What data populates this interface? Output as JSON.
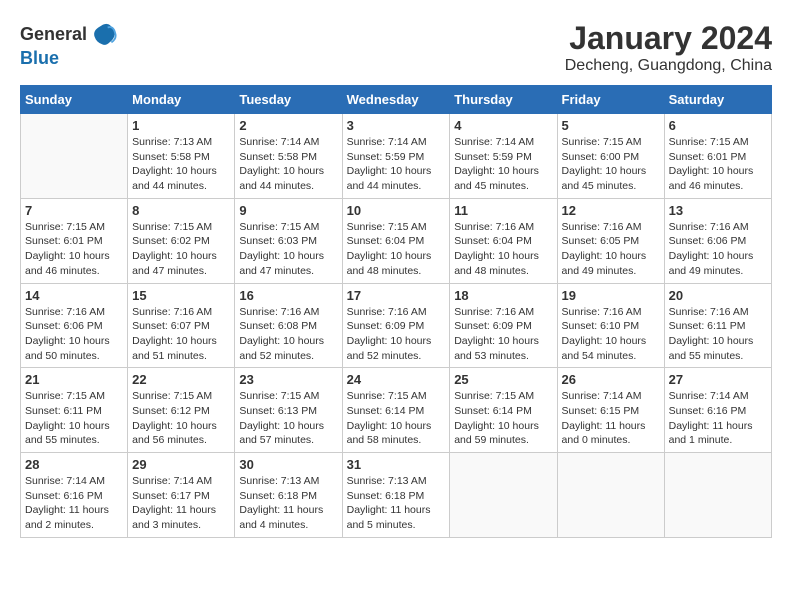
{
  "header": {
    "logo_general": "General",
    "logo_blue": "Blue",
    "month": "January 2024",
    "location": "Decheng, Guangdong, China"
  },
  "days_of_week": [
    "Sunday",
    "Monday",
    "Tuesday",
    "Wednesday",
    "Thursday",
    "Friday",
    "Saturday"
  ],
  "weeks": [
    [
      {
        "day": "",
        "info": ""
      },
      {
        "day": "1",
        "info": "Sunrise: 7:13 AM\nSunset: 5:58 PM\nDaylight: 10 hours\nand 44 minutes."
      },
      {
        "day": "2",
        "info": "Sunrise: 7:14 AM\nSunset: 5:58 PM\nDaylight: 10 hours\nand 44 minutes."
      },
      {
        "day": "3",
        "info": "Sunrise: 7:14 AM\nSunset: 5:59 PM\nDaylight: 10 hours\nand 44 minutes."
      },
      {
        "day": "4",
        "info": "Sunrise: 7:14 AM\nSunset: 5:59 PM\nDaylight: 10 hours\nand 45 minutes."
      },
      {
        "day": "5",
        "info": "Sunrise: 7:15 AM\nSunset: 6:00 PM\nDaylight: 10 hours\nand 45 minutes."
      },
      {
        "day": "6",
        "info": "Sunrise: 7:15 AM\nSunset: 6:01 PM\nDaylight: 10 hours\nand 46 minutes."
      }
    ],
    [
      {
        "day": "7",
        "info": "Sunrise: 7:15 AM\nSunset: 6:01 PM\nDaylight: 10 hours\nand 46 minutes."
      },
      {
        "day": "8",
        "info": "Sunrise: 7:15 AM\nSunset: 6:02 PM\nDaylight: 10 hours\nand 47 minutes."
      },
      {
        "day": "9",
        "info": "Sunrise: 7:15 AM\nSunset: 6:03 PM\nDaylight: 10 hours\nand 47 minutes."
      },
      {
        "day": "10",
        "info": "Sunrise: 7:15 AM\nSunset: 6:04 PM\nDaylight: 10 hours\nand 48 minutes."
      },
      {
        "day": "11",
        "info": "Sunrise: 7:16 AM\nSunset: 6:04 PM\nDaylight: 10 hours\nand 48 minutes."
      },
      {
        "day": "12",
        "info": "Sunrise: 7:16 AM\nSunset: 6:05 PM\nDaylight: 10 hours\nand 49 minutes."
      },
      {
        "day": "13",
        "info": "Sunrise: 7:16 AM\nSunset: 6:06 PM\nDaylight: 10 hours\nand 49 minutes."
      }
    ],
    [
      {
        "day": "14",
        "info": "Sunrise: 7:16 AM\nSunset: 6:06 PM\nDaylight: 10 hours\nand 50 minutes."
      },
      {
        "day": "15",
        "info": "Sunrise: 7:16 AM\nSunset: 6:07 PM\nDaylight: 10 hours\nand 51 minutes."
      },
      {
        "day": "16",
        "info": "Sunrise: 7:16 AM\nSunset: 6:08 PM\nDaylight: 10 hours\nand 52 minutes."
      },
      {
        "day": "17",
        "info": "Sunrise: 7:16 AM\nSunset: 6:09 PM\nDaylight: 10 hours\nand 52 minutes."
      },
      {
        "day": "18",
        "info": "Sunrise: 7:16 AM\nSunset: 6:09 PM\nDaylight: 10 hours\nand 53 minutes."
      },
      {
        "day": "19",
        "info": "Sunrise: 7:16 AM\nSunset: 6:10 PM\nDaylight: 10 hours\nand 54 minutes."
      },
      {
        "day": "20",
        "info": "Sunrise: 7:16 AM\nSunset: 6:11 PM\nDaylight: 10 hours\nand 55 minutes."
      }
    ],
    [
      {
        "day": "21",
        "info": "Sunrise: 7:15 AM\nSunset: 6:11 PM\nDaylight: 10 hours\nand 55 minutes."
      },
      {
        "day": "22",
        "info": "Sunrise: 7:15 AM\nSunset: 6:12 PM\nDaylight: 10 hours\nand 56 minutes."
      },
      {
        "day": "23",
        "info": "Sunrise: 7:15 AM\nSunset: 6:13 PM\nDaylight: 10 hours\nand 57 minutes."
      },
      {
        "day": "24",
        "info": "Sunrise: 7:15 AM\nSunset: 6:14 PM\nDaylight: 10 hours\nand 58 minutes."
      },
      {
        "day": "25",
        "info": "Sunrise: 7:15 AM\nSunset: 6:14 PM\nDaylight: 10 hours\nand 59 minutes."
      },
      {
        "day": "26",
        "info": "Sunrise: 7:14 AM\nSunset: 6:15 PM\nDaylight: 11 hours\nand 0 minutes."
      },
      {
        "day": "27",
        "info": "Sunrise: 7:14 AM\nSunset: 6:16 PM\nDaylight: 11 hours\nand 1 minute."
      }
    ],
    [
      {
        "day": "28",
        "info": "Sunrise: 7:14 AM\nSunset: 6:16 PM\nDaylight: 11 hours\nand 2 minutes."
      },
      {
        "day": "29",
        "info": "Sunrise: 7:14 AM\nSunset: 6:17 PM\nDaylight: 11 hours\nand 3 minutes."
      },
      {
        "day": "30",
        "info": "Sunrise: 7:13 AM\nSunset: 6:18 PM\nDaylight: 11 hours\nand 4 minutes."
      },
      {
        "day": "31",
        "info": "Sunrise: 7:13 AM\nSunset: 6:18 PM\nDaylight: 11 hours\nand 5 minutes."
      },
      {
        "day": "",
        "info": ""
      },
      {
        "day": "",
        "info": ""
      },
      {
        "day": "",
        "info": ""
      }
    ]
  ]
}
